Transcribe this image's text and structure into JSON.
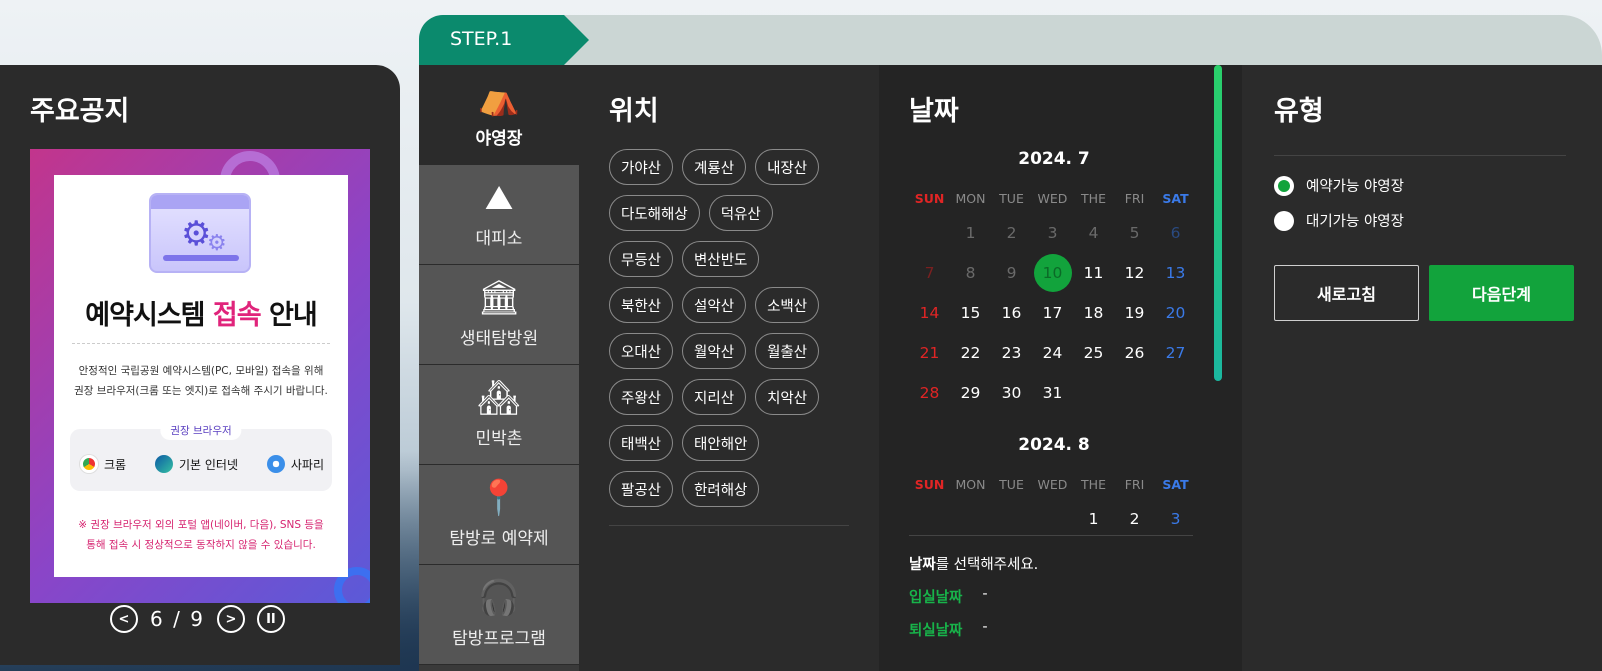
{
  "notice": {
    "title": "주요공지",
    "banner": {
      "heading_main": "예약시스템 ",
      "heading_highlight": "접속",
      "heading_tail": " 안내",
      "desc_line1": "안정적인 국립공원 예약시스템(PC, 모바일) 접속을 위해",
      "desc_line2": "권장 브라우저(크롬 또는 엣지)로 접속해 주시기 바랍니다.",
      "browser_tag": "권장 브라우저",
      "browsers": [
        "크롬",
        "기본 인터넷",
        "사파리"
      ],
      "warn_line1": "※ 권장 브라우저 외의 포털 앱(네이버, 다음), SNS 등을",
      "warn_line2": "통해 접속 시 정상적으로 동작하지 않을 수 있습니다."
    },
    "pager": {
      "current": "6",
      "separator": "/",
      "total": "9"
    }
  },
  "step": {
    "label": "STEP.1"
  },
  "categories": [
    {
      "label": "야영장",
      "icon": "tent-icon",
      "active": true
    },
    {
      "label": "대피소",
      "icon": "shelter-icon",
      "active": false
    },
    {
      "label": "생태탐방원",
      "icon": "eco-center-icon",
      "active": false
    },
    {
      "label": "민박촌",
      "icon": "village-icon",
      "active": false
    },
    {
      "label": "탐방로 예약제",
      "icon": "trail-icon",
      "active": false
    },
    {
      "label": "탐방프로그램",
      "icon": "program-icon",
      "active": false
    }
  ],
  "location": {
    "title": "위치",
    "rows": [
      [
        "가야산",
        "계룡산",
        "내장산"
      ],
      [
        "다도해해상",
        "덕유산"
      ],
      [
        "무등산",
        "변산반도"
      ],
      [
        "북한산",
        "설악산",
        "소백산"
      ],
      [
        "오대산",
        "월악산",
        "월출산"
      ],
      [
        "주왕산",
        "지리산",
        "치악산"
      ],
      [
        "태백산",
        "태안해안"
      ],
      [
        "팔공산",
        "한려해상"
      ]
    ]
  },
  "date": {
    "title": "날짜",
    "weekdays": [
      "SUN",
      "MON",
      "TUE",
      "WED",
      "THE",
      "FRI",
      "SAT"
    ],
    "months": [
      {
        "label": "2024. 7",
        "weeks": [
          [
            "",
            "1",
            "2",
            "3",
            "4",
            "5",
            "6"
          ],
          [
            "7",
            "8",
            "9",
            "10",
            "11",
            "12",
            "13"
          ],
          [
            "14",
            "15",
            "16",
            "17",
            "18",
            "19",
            "20"
          ],
          [
            "21",
            "22",
            "23",
            "24",
            "25",
            "26",
            "27"
          ],
          [
            "28",
            "29",
            "30",
            "31",
            "",
            "",
            ""
          ]
        ],
        "disabled_upto": 10,
        "today": "10"
      },
      {
        "label": "2024. 8",
        "weeks": [
          [
            "",
            "",
            "",
            "",
            "1",
            "2",
            "3"
          ]
        ],
        "disabled_upto": 0,
        "today": ""
      }
    ],
    "prompt_bold": "날짜",
    "prompt_rest": "를 선택해주세요.",
    "checkin_label": "입실날짜",
    "checkin_value": "-",
    "checkout_label": "퇴실날짜",
    "checkout_value": "-"
  },
  "type": {
    "title": "유형",
    "options": [
      {
        "label": "예약가능 야영장",
        "checked": true
      },
      {
        "label": "대기가능 야영장",
        "checked": false
      }
    ],
    "refresh_label": "새로고침",
    "next_label": "다음단계"
  },
  "colors": {
    "accent_green": "#12a33c",
    "step_green": "#0b8a6d",
    "panel_dark": "#2b2b2b",
    "sunday_red": "#e02525",
    "saturday_blue": "#3a7ae8",
    "highlight_pink": "#e0247b"
  }
}
